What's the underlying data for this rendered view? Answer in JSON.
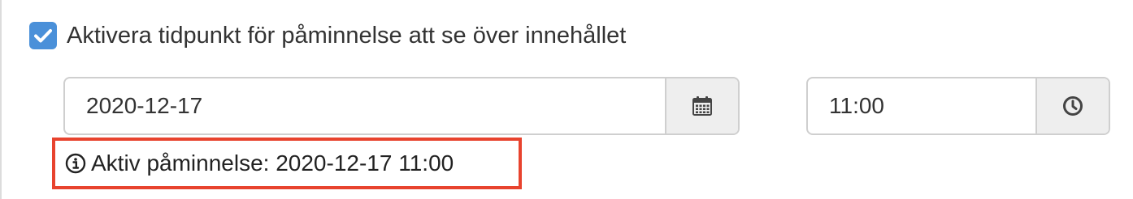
{
  "reminder_toggle": {
    "checked": true,
    "label": "Aktivera tidpunkt för påminnelse att se över innehållet"
  },
  "date_field": {
    "value": "2020-12-17",
    "icon": "calendar-icon"
  },
  "time_field": {
    "value": "11:00",
    "icon": "clock-icon"
  },
  "active_reminder": {
    "icon": "info-icon",
    "text": "Aktiv påminnelse: 2020-12-17 11:00",
    "highlight_color": "#e8432e"
  },
  "colors": {
    "accent": "#4a90d9",
    "addon_bg": "#eeeeee",
    "border": "#cfcfcf"
  }
}
